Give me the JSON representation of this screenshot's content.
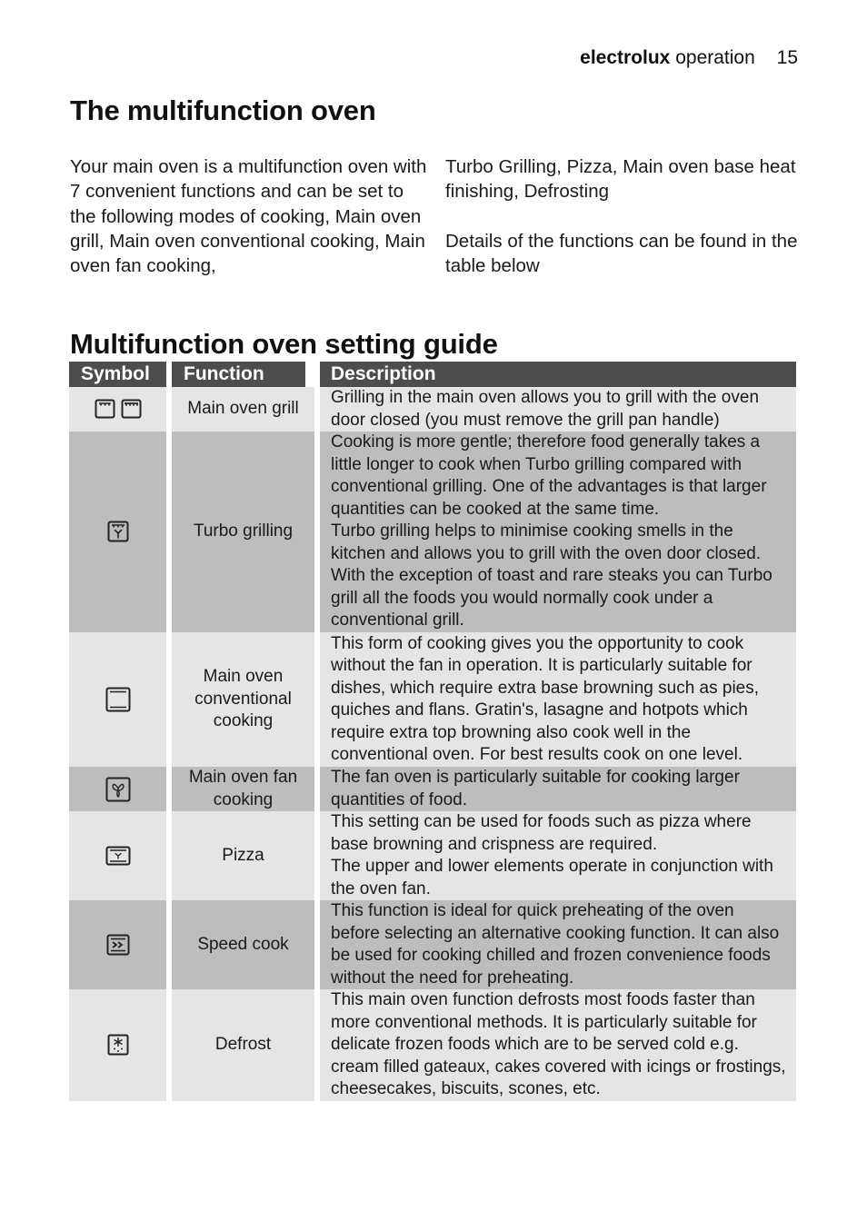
{
  "header": {
    "brand": "electrolux",
    "section": "operation",
    "page_number": "15"
  },
  "title": "The multifunction oven",
  "intro": {
    "left": "Your main oven is a multifunction oven with 7 convenient functions and can be set to the following modes of cooking, Main oven grill, Main oven conventional cooking, Main oven fan cooking,",
    "right_1": "Turbo Grilling, Pizza, Main oven base heat finishing, Defrosting",
    "right_2": "Details of the functions can be found in the table below"
  },
  "guide": {
    "title": "Multifunction oven setting guide",
    "columns": [
      "Symbol",
      "Function",
      "Description"
    ],
    "rows": [
      {
        "icon": "grill-icon",
        "function": "Main oven grill",
        "description": "Grilling in the main oven allows you to grill with the oven door closed (you must remove the grill pan handle)"
      },
      {
        "icon": "turbo-grill-icon",
        "function": "Turbo grilling",
        "description": "Cooking is more gentle; therefore food generally takes a little longer to cook when Turbo grilling compared with conventional grilling.  One of the advantages is that larger quantities can be cooked at the same time.",
        "description_2": "Turbo grilling helps to minimise cooking smells in the kitchen and allows you to grill with the oven door closed. With the exception of toast and rare steaks you can Turbo grill all the foods you would normally cook under a conventional grill."
      },
      {
        "icon": "conventional-icon",
        "function": "Main oven conventional cooking",
        "description": "This form of cooking gives you the opportunity to cook without the fan in operation.  It is particularly suitable for dishes, which require extra base browning such as pies, quiches and flans.  Gratin's, lasagne and hotpots which require extra top browning also cook well in the conventional oven.  For best results cook on one level."
      },
      {
        "icon": "fan-icon",
        "function": "Main oven fan cooking",
        "description": "The fan oven is particularly suitable for cooking larger quantities of food."
      },
      {
        "icon": "pizza-icon",
        "function": "Pizza",
        "description": "This setting can be used for foods such as pizza where base browning and crispness are required.",
        "description_2": "The upper and lower elements operate in conjunction with the oven fan."
      },
      {
        "icon": "speed-cook-icon",
        "function": "Speed cook",
        "description": "This function is ideal for quick preheating of the oven before selecting an alternative cooking function.  It can also be used for cooking chilled and frozen convenience foods without the need for preheating."
      },
      {
        "icon": "defrost-icon",
        "function": "Defrost",
        "description": "This main oven function defrosts most foods faster than more conventional methods. It is particularly suitable for delicate frozen foods which are to be served cold e.g. cream filled gateaux, cakes covered with icings or frostings, cheesecakes, biscuits, scones, etc."
      }
    ]
  }
}
